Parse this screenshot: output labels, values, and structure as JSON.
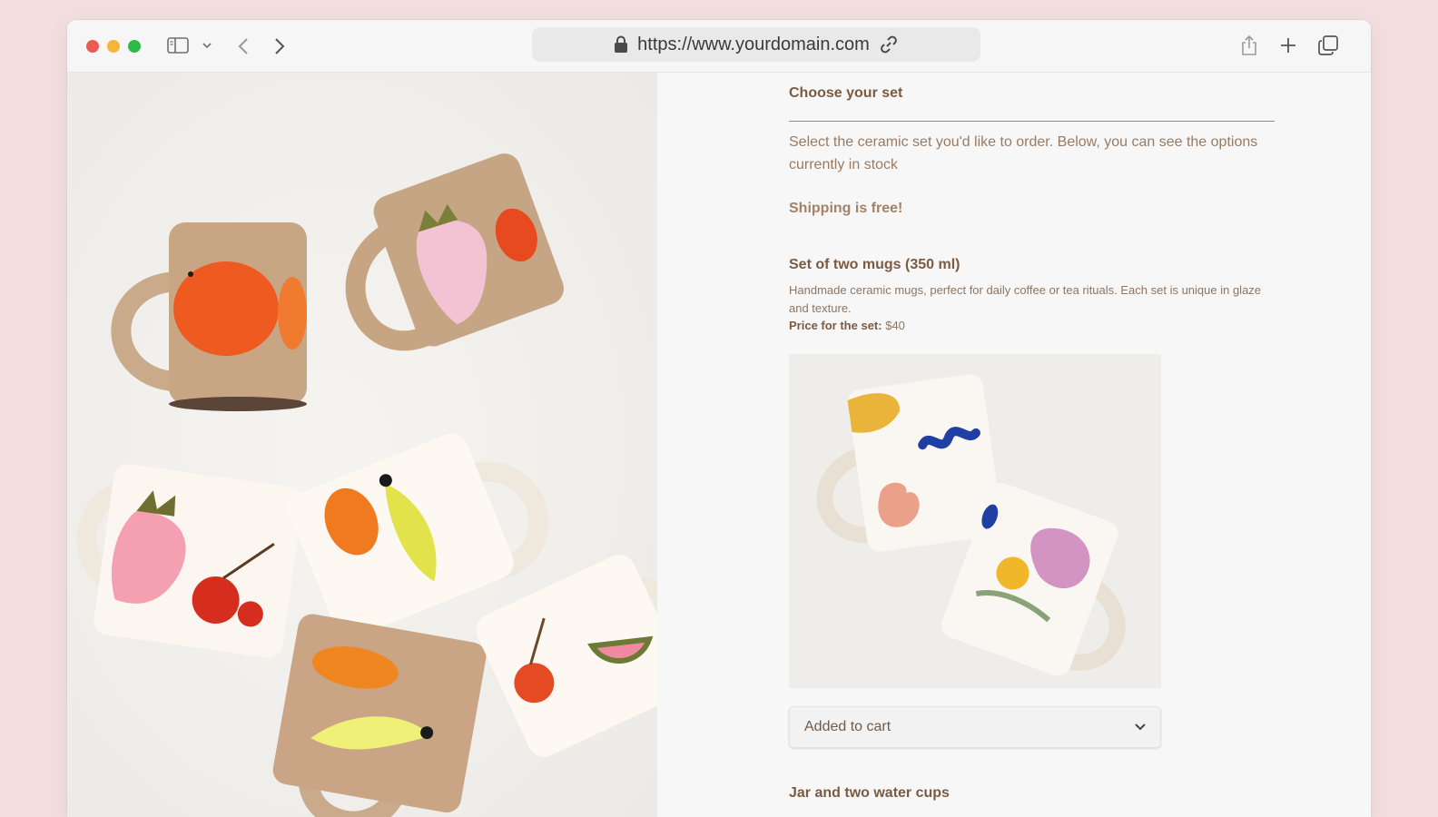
{
  "browser": {
    "url": "https://www.yourdomain.com",
    "icons": [
      "sidebar-icon",
      "chevron-down-icon",
      "back-icon",
      "forward-icon",
      "lock-icon",
      "link-icon",
      "share-icon",
      "new-tab-icon",
      "tabs-overview-icon"
    ]
  },
  "product": {
    "section_title": "Choose your set",
    "intro": "Select the ceramic set you'd like to order. Below, you can see the options currently in stock",
    "shipping": "Shipping is free!",
    "set": {
      "title": "Set of two mugs (350 ml)",
      "description": "Handmade ceramic mugs, perfect for daily coffee or tea rituals. Each set is unique in glaze and texture.",
      "price_label": "Price for the set:",
      "price_value": "$40",
      "select_value": "Added to cart"
    },
    "next_set_title": "Jar and two water cups"
  },
  "colors": {
    "page_bg": "#f2dede",
    "text_brown": "#7a5b42",
    "text_light": "#9a7b62"
  }
}
